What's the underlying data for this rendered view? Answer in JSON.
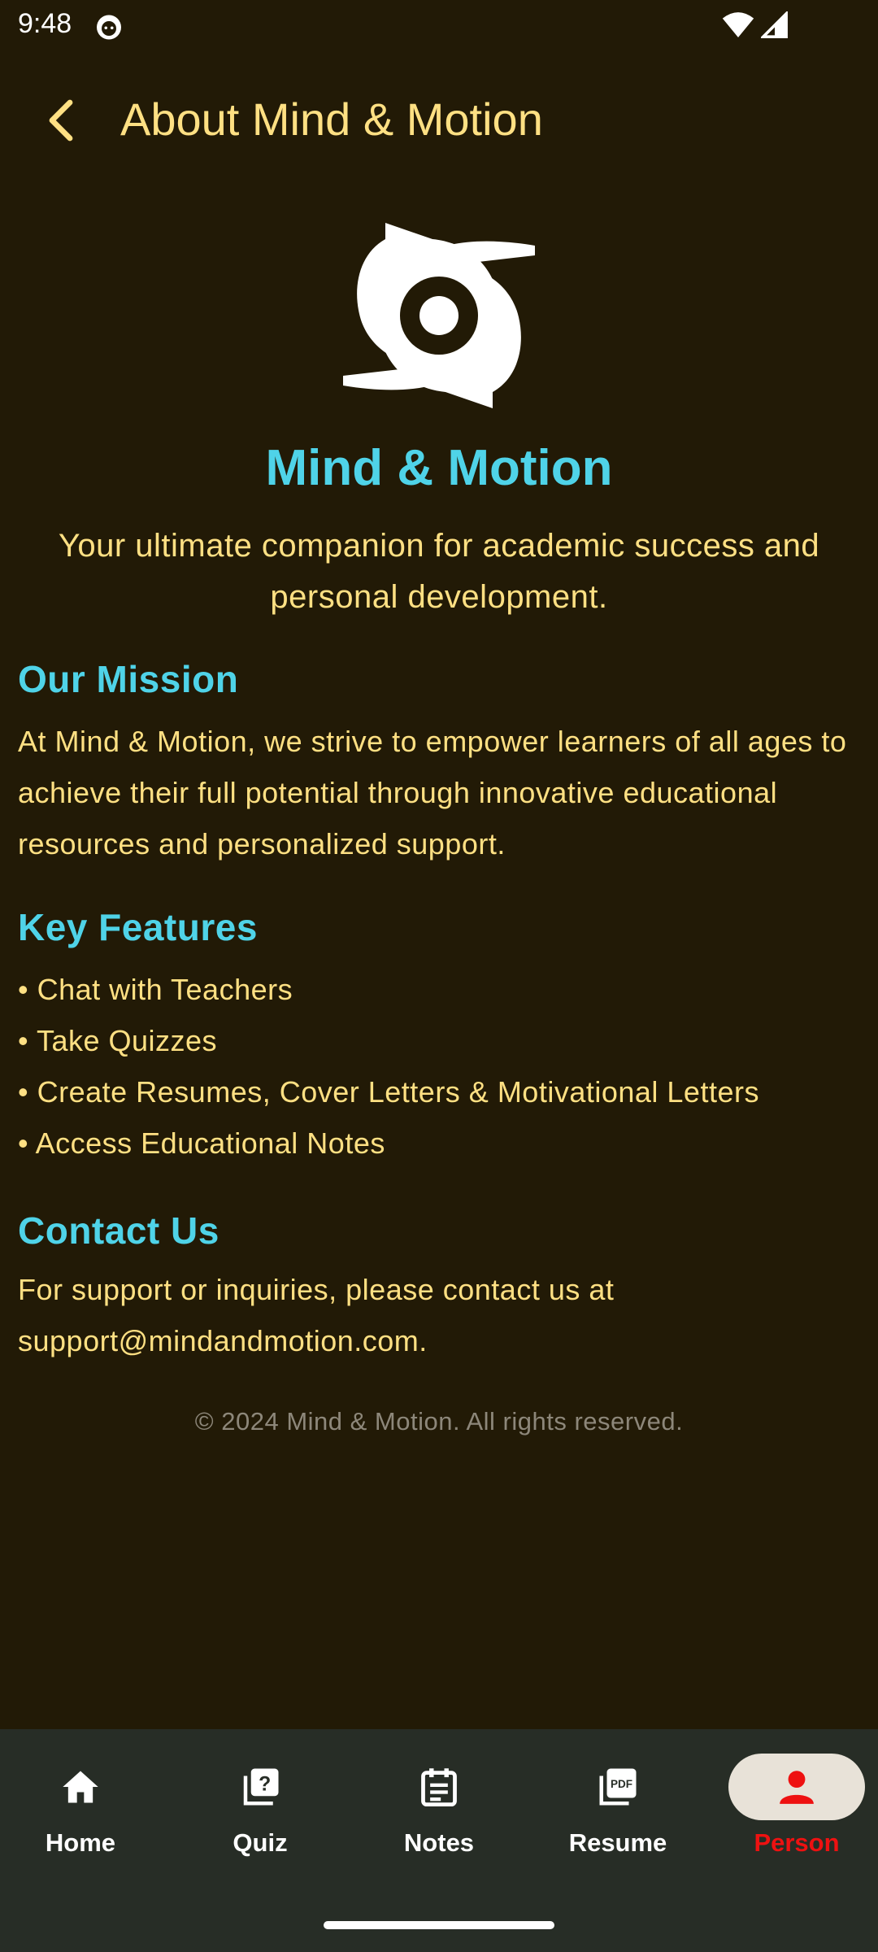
{
  "status_bar": {
    "time": "9:48",
    "app_icon": "cat-face-icon",
    "wifi_icon": "wifi-icon",
    "signal_icon": "cellular-signal-icon"
  },
  "top_bar": {
    "back_icon": "chevron-left-icon",
    "title": "About Mind & Motion"
  },
  "header": {
    "logo_icon": "hurricane-swirl-icon",
    "app_name": "Mind & Motion",
    "tagline": "Your ultimate companion for academic success and personal development."
  },
  "mission": {
    "heading": "Our Mission",
    "body": "At Mind & Motion, we strive to empower learners of all ages to achieve their full potential through innovative educational resources and personalized support."
  },
  "features": {
    "heading": "Key Features",
    "items": [
      "• Chat with Teachers",
      "• Take Quizzes",
      "• Create Resumes, Cover Letters & Motivational Letters",
      "• Access Educational Notes"
    ]
  },
  "contact": {
    "heading": "Contact Us",
    "body": "For support or inquiries, please contact us at support@mindandmotion.com."
  },
  "footer": {
    "copyright": "© 2024 Mind & Motion. All rights reserved."
  },
  "bottom_nav": {
    "items": [
      {
        "label": "Home",
        "icon": "home-icon",
        "active": false
      },
      {
        "label": "Quiz",
        "icon": "quiz-icon",
        "active": false
      },
      {
        "label": "Notes",
        "icon": "notes-icon",
        "active": false
      },
      {
        "label": "Resume",
        "icon": "pdf-icon",
        "active": false
      },
      {
        "label": "Person",
        "icon": "person-icon",
        "active": true
      }
    ]
  },
  "colors": {
    "background": "#221a06",
    "title_yellow": "#ffe083",
    "accent_cyan": "#4fd3e8",
    "nav_background": "#272d26",
    "active_red": "#ee1111",
    "active_pill": "#e8e2d8"
  }
}
